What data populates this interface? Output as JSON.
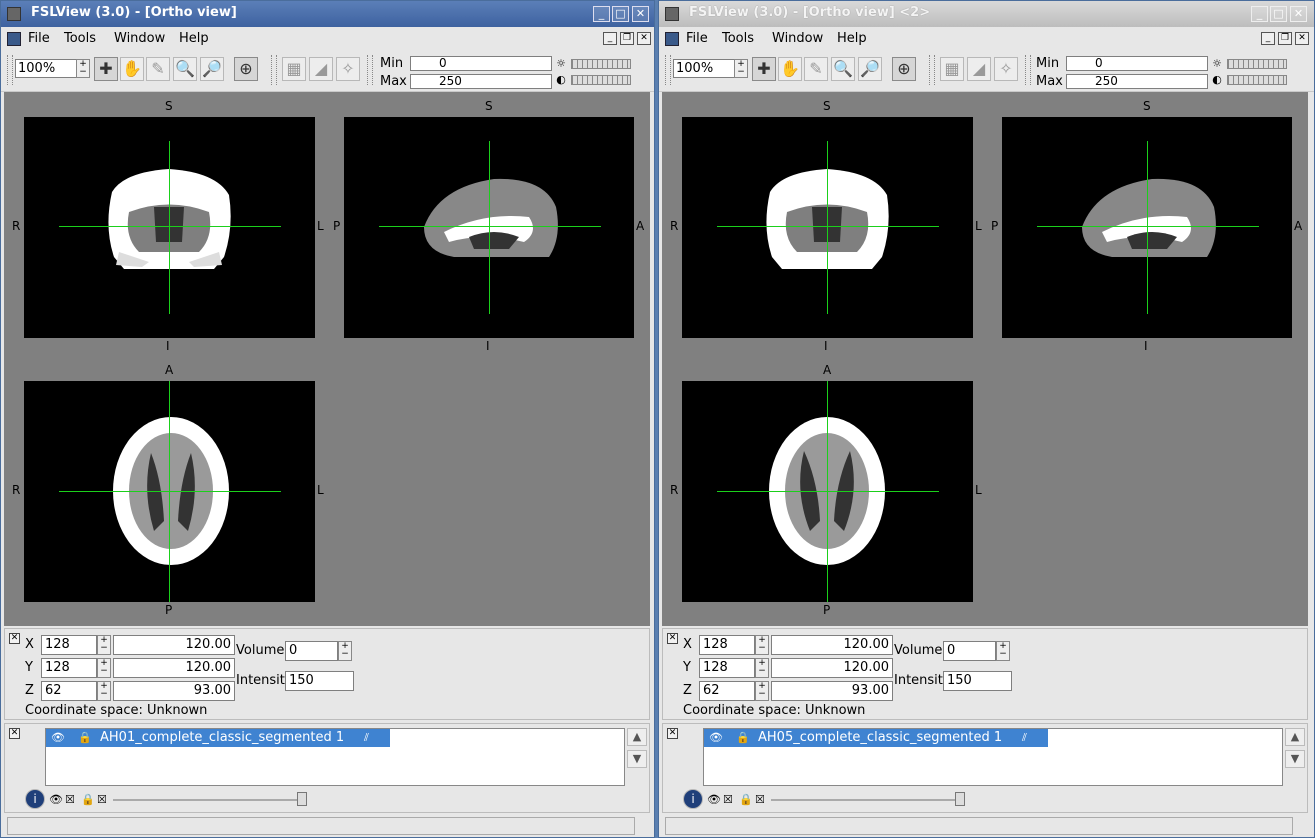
{
  "windows": [
    {
      "title": "FSLView (3.0) - [Ortho view]",
      "menus": [
        "File",
        "Tools",
        "Window",
        "Help"
      ],
      "zoom": "100%",
      "min_label": "Min",
      "min_value": "0",
      "max_label": "Max",
      "max_value": "250",
      "orient": {
        "coronal": [
          "S",
          "I",
          "R",
          "L"
        ],
        "sagittal": [
          "S",
          "I",
          "P",
          "A"
        ],
        "axial": [
          "A",
          "P",
          "R",
          "L"
        ]
      },
      "coords": {
        "x_label": "X",
        "x_vox": "128",
        "x_mm": "120.00",
        "y_label": "Y",
        "y_vox": "128",
        "y_mm": "120.00",
        "z_label": "Z",
        "z_vox": "62",
        "z_mm": "93.00",
        "volume_label": "Volume",
        "volume_value": "0",
        "intensity_label": "Intensity",
        "intensity_value": "150",
        "space": "Coordinate space: Unknown"
      },
      "layer": "AH01_complete_classic_segmented 1"
    },
    {
      "title": "FSLView (3.0) - [Ortho view] <2>",
      "menus": [
        "File",
        "Tools",
        "Window",
        "Help"
      ],
      "zoom": "100%",
      "min_label": "Min",
      "min_value": "0",
      "max_label": "Max",
      "max_value": "250",
      "orient": {
        "coronal": [
          "S",
          "I",
          "R",
          "L"
        ],
        "sagittal": [
          "S",
          "I",
          "P",
          "A"
        ],
        "axial": [
          "A",
          "P",
          "R",
          "L"
        ]
      },
      "coords": {
        "x_label": "X",
        "x_vox": "128",
        "x_mm": "120.00",
        "y_label": "Y",
        "y_vox": "128",
        "y_mm": "120.00",
        "z_label": "Z",
        "z_vox": "62",
        "z_mm": "93.00",
        "volume_label": "Volume",
        "volume_value": "0",
        "intensity_label": "Intensity",
        "intensity_value": "150",
        "space": "Coordinate space: Unknown"
      },
      "layer": "AH05_complete_classic_segmented 1"
    }
  ],
  "icons": {
    "title_buttons": [
      "minimize-icon",
      "maximize-icon",
      "close-icon"
    ],
    "tools": [
      "crosshair-tool-icon",
      "hand-pan-icon",
      "pencil-icon",
      "zoom-in-icon",
      "zoom-out-icon",
      "cursor-target-icon",
      "mask-icon",
      "fill-icon",
      "magic-wand-icon"
    ]
  },
  "colors": {
    "cursor": "#1bd01b",
    "layer_highlight": "#3f83d1",
    "title_active": "#4a6fae"
  }
}
